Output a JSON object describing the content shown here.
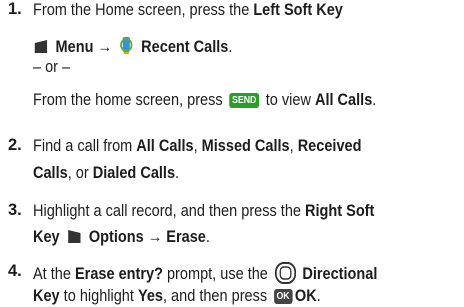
{
  "step1": {
    "num": "1.",
    "l1a": "From the Home screen, press the ",
    "l1b": "Left Soft Key",
    "l2a": "Menu → ",
    "l2b": "Recent Calls",
    "l2c": ".",
    "or": "– or –",
    "l4a": "From the home screen, press ",
    "send": "SEND",
    "l4b": " to view ",
    "l4c": "All Calls",
    "l4d": "."
  },
  "step2": {
    "num": "2.",
    "l1a": "Find a call from ",
    "l1b": "All Calls",
    "l1c": ", ",
    "l1d": "Missed Calls",
    "l1e": ", ",
    "l1f": "Received",
    "l2a": "Calls",
    "l2b": ", or ",
    "l2c": "Dialed Calls",
    "l2d": "."
  },
  "step3": {
    "num": "3.",
    "l1a": "Highlight a call record, and then press the ",
    "l1b": "Right Soft",
    "l2a": "Key",
    "l2b": "Options → Erase",
    "l2c": "."
  },
  "step4": {
    "num": "4.",
    "l1a": "At the ",
    "l1b": "Erase entry?",
    "l1c": " prompt, use the ",
    "l1d": "Directional",
    "l2a": "Key",
    "l2b": " to highlight ",
    "l2c": "Yes",
    "l2d": ", and then press ",
    "ok": "OK",
    "l2e": "OK",
    "l2f": "."
  },
  "colors": {
    "send_key": "#2d9a2d",
    "ok_key": "#444444",
    "text": "#1d1d1d"
  }
}
